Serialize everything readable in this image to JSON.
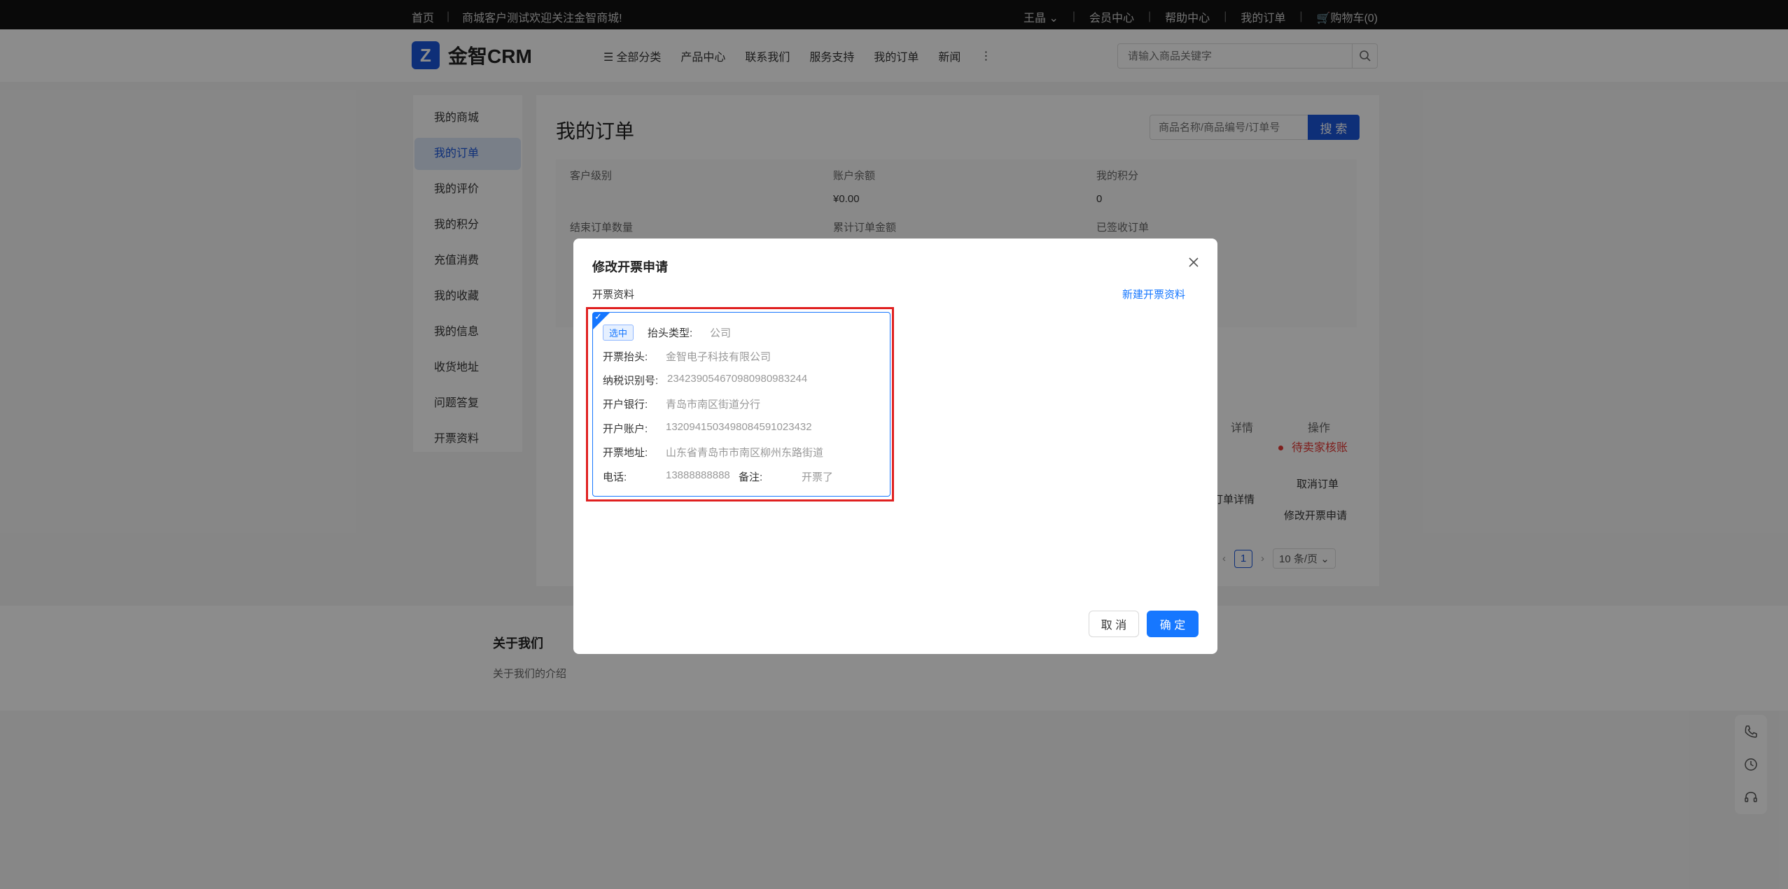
{
  "topbar": {
    "home": "首页",
    "welcome": "商城客户测试欢迎关注金智商城!",
    "user": "王晶",
    "member_center": "会员中心",
    "help_center": "帮助中心",
    "my_orders": "我的订单",
    "cart": "购物车(0)"
  },
  "header": {
    "logo_text": "金智CRM",
    "nav": [
      "全部分类",
      "产品中心",
      "联系我们",
      "服务支持",
      "我的订单",
      "新闻"
    ],
    "search_placeholder": "请输入商品关键字"
  },
  "sidebar": {
    "items": [
      "我的商城",
      "我的订单",
      "我的评价",
      "我的积分",
      "充值消费",
      "我的收藏",
      "我的信息",
      "收货地址",
      "问题答复",
      "开票资料"
    ],
    "active_index": 1
  },
  "main": {
    "title": "我的订单",
    "search_placeholder": "商品名称/商品编号/订单号",
    "search_button": "搜 索",
    "stats": {
      "customer_level_label": "客户级别",
      "balance_label": "账户余额",
      "balance_value": "¥0.00",
      "points_label": "我的积分",
      "points_value": "0",
      "settled_count_label": "结束订单数量",
      "total_amount_label": "累计订单金额",
      "received_label": "已签收订单"
    },
    "table": {
      "col_detail": "详情",
      "col_action": "操作",
      "status": "待卖家核账",
      "order_detail": "订单详情",
      "cancel_order": "取消订单",
      "modify_invoice": "修改开票申请"
    },
    "pager": {
      "current": "1",
      "page_size": "10 条/页"
    }
  },
  "footer": {
    "title": "关于我们",
    "text": "关于我们的介绍"
  },
  "modal": {
    "title": "修改开票申请",
    "section_label": "开票资料",
    "new_link": "新建开票资料",
    "card": {
      "tag": "选中",
      "header_type_label": "抬头类型:",
      "header_type_value": "公司",
      "invoice_header_label": "开票抬头:",
      "invoice_header_value": "金智电子科技有限公司",
      "tax_id_label": "纳税识别号:",
      "tax_id_value": "234239054670980980983244",
      "bank_label": "开户银行:",
      "bank_value": "青岛市南区街道分行",
      "account_label": "开户账户:",
      "account_value": "13209415034980845910234​32",
      "address_label": "开票地址:",
      "address_value": "山东省青岛市市南区柳州东路街道",
      "phone_label": "电话:",
      "phone_value": "13888888888",
      "note_label": "备注:",
      "note_value": "开票了"
    },
    "cancel_button": "取 消",
    "ok_button": "确 定"
  },
  "colors": {
    "primary": "#1677ff",
    "brand": "#1a56db",
    "danger": "#e02020"
  }
}
